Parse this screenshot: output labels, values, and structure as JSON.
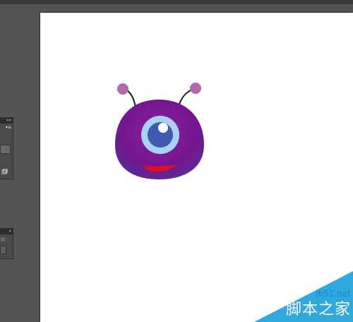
{
  "app": {
    "canvas_background": "#ffffff",
    "workspace_background": "#545454"
  },
  "panels": {
    "panel_1_tab_glyph": "«× ",
    "panel_1_menu_glyph": "▾≡",
    "panel_2_tab_glyph": "×"
  },
  "artwork": {
    "body_color": "#7a1a98",
    "eye_ring_color": "#a8d3ee",
    "iris_color": "#3f5bb0",
    "mouth_color": "#e0101f",
    "antenna_ball_color": "#b36aad",
    "icon": "one-eyed-monster-illustration"
  },
  "watermark": {
    "site": "jb51.net",
    "name": "脚本之家",
    "accent_color": "#2fa8e0"
  }
}
